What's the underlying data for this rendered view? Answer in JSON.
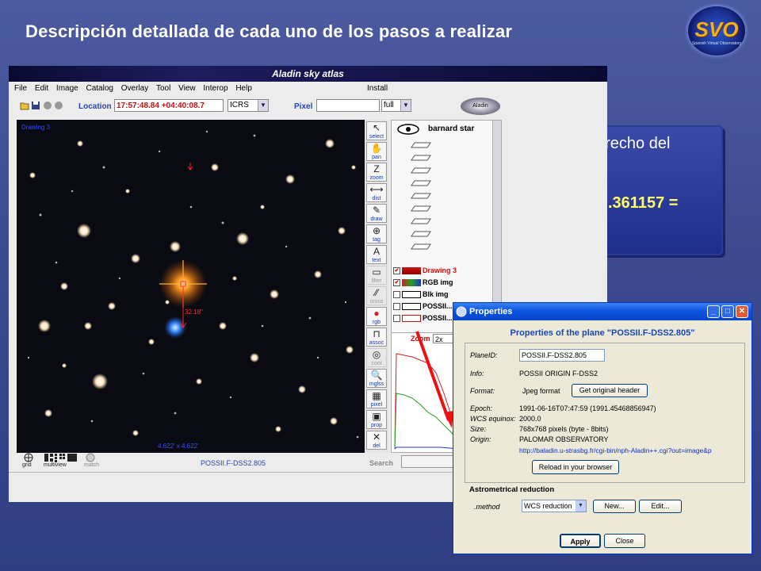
{
  "slide": {
    "title": "Descripción detallada de cada uno de los pasos a realizar",
    "logo_text": "SVO",
    "logo_subtext": "Spanish Virtual Observatory"
  },
  "background_box": {
    "line1_visible": "erecho del",
    "line2_visible": ".361157  ="
  },
  "aladin": {
    "window_title": "Aladin sky atlas",
    "menu": [
      "File",
      "Edit",
      "Image",
      "Catalog",
      "Overlay",
      "Tool",
      "View",
      "Interop",
      "Help"
    ],
    "menu_install": "Install",
    "location_label": "Location",
    "location_value": "17:57:48.84 +04:40:08.7",
    "frame_value": "ICRS",
    "pixel_label": "Pixel",
    "pixel_mode": "full",
    "logo_text": "Aladin",
    "sky_overlay": {
      "top_left": "Drawing 3",
      "measure_label": "32.18\"",
      "bottom_center": "4.622' x 4.622'"
    },
    "tools": [
      {
        "label": "select",
        "glyph": "↖"
      },
      {
        "label": "pan",
        "glyph": "✋"
      },
      {
        "label": "zoom",
        "glyph": "Z"
      },
      {
        "label": "dist",
        "glyph": "⟷"
      },
      {
        "label": "draw",
        "glyph": "✎"
      },
      {
        "label": "tag",
        "glyph": "⊕"
      },
      {
        "label": "text",
        "glyph": "A"
      },
      {
        "label": "filter",
        "glyph": "▭"
      },
      {
        "label": "cross",
        "glyph": "⁄⁄"
      },
      {
        "label": "rgb",
        "glyph": "●"
      },
      {
        "label": "assoc",
        "glyph": "⊓"
      },
      {
        "label": "cont",
        "glyph": "◎"
      },
      {
        "label": "mglss",
        "glyph": "🔍"
      },
      {
        "label": "pixel",
        "glyph": "▦"
      },
      {
        "label": "prop",
        "glyph": "▣"
      },
      {
        "label": "del",
        "glyph": "✕"
      }
    ],
    "stack_title": "barnard star",
    "layers": [
      {
        "name": "Drawing 3",
        "checked": true,
        "color": "#d01010"
      },
      {
        "name": "RGB img",
        "checked": true,
        "color": "#000000"
      },
      {
        "name": "Blk img",
        "checked": false,
        "color": "#000000"
      },
      {
        "name": "POSSII...",
        "checked": false,
        "color": "#000000"
      },
      {
        "name": "POSSII...",
        "checked": false,
        "color": "#000000"
      }
    ],
    "zoom_label": "Zoom",
    "zoom_value": "2x",
    "status_plane": "POSSII.F-DSS2.805",
    "status_search": "Search",
    "bottom_buttons": [
      "grid",
      "multiview",
      "match"
    ]
  },
  "properties": {
    "window_title": "Properties",
    "heading": "Properties of the plane \"POSSII.F-DSS2.805\"",
    "plane_id_label": "PlaneID:",
    "plane_id_value": "POSSII.F-DSS2.805",
    "info_label": "Info:",
    "info_value": "POSSII  ORIGIN    F-DSS2",
    "format_label": "Format:",
    "format_value": "Jpeg format",
    "get_header_button": "Get original header",
    "epoch_label": "Epoch:",
    "epoch_value": "1991-06-16T07:47:59 (1991.45468856947)",
    "wcs_label": "WCS equinox:",
    "wcs_value": "2000.0",
    "size_label": "Size:",
    "size_value": "768x768 pixels (byte - 8bits)",
    "origin_label": "Origin:",
    "origin_value": "PALOMAR OBSERVATORY",
    "url_value": "http://baladin.u-strasbg.fr/cgi-bin/nph-Aladin++.cgi?out=image&p",
    "reload_button": "Reload in your browser",
    "astrometry_heading": "Astrometrical reduction",
    "method_label": ".method",
    "method_value": "WCS reduction",
    "new_button": "New...",
    "edit_button": "Edit...",
    "apply_button": "Apply",
    "close_button": "Close"
  }
}
